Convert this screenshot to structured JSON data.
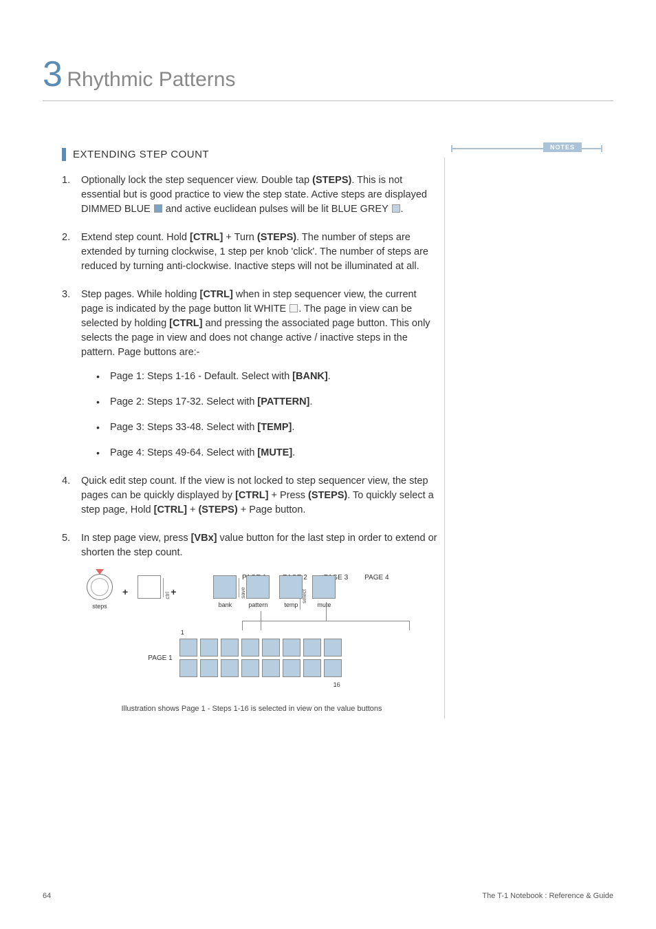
{
  "chapter": {
    "number": "3",
    "title": "Rhythmic Patterns"
  },
  "notes_label": "NOTES",
  "section_title": "EXTENDING STEP COUNT",
  "steps": {
    "s1a": "Optionally lock the step sequencer view. Double tap ",
    "s1b": ". This is not essential but is good practice to view the step state. Active steps are displayed DIMMED BLUE ",
    "s1c": " and active euclidean pulses will be lit BLUE GREY ",
    "s1d": ".",
    "kw_steps": "(STEPS)",
    "s2a": "Extend step count. Hold ",
    "s2b": " + Turn ",
    "s2c": ". The number of steps are extended by turning clockwise, 1 step per knob 'click'. The number of steps are reduced by turning anti-clockwise. Inactive steps will not be illuminated at all.",
    "kw_ctrl": "[CTRL]",
    "s3a": "Step pages. While holding ",
    "s3b": " when in step sequencer view, the current page is indicated by the page button lit WHITE ",
    "s3c": ". The page in view can be selected by holding ",
    "s3d": " and pressing the associated page button. This only selects the page in view and does not change active / inactive steps in the pattern. Page buttons are:-",
    "sub1a": "Page 1: Steps 1-16 - Default. Select with ",
    "sub1b": ".",
    "kw_bank": "[BANK]",
    "sub2a": "Page 2: Steps 17-32. Select with ",
    "kw_pattern": "[PATTERN]",
    "sub3a": "Page 3: Steps 33-48. Select with ",
    "kw_temp": "[TEMP]",
    "sub4a": "Page 4: Steps 49-64. Select with ",
    "kw_mute": "[MUTE]",
    "s4a": "Quick edit step count. If the view is not locked to step sequencer view, the step pages can be quickly displayed by ",
    "s4b": " + Press ",
    "s4c": ". To quickly select a step page, Hold ",
    "s4d": " + ",
    "s4e": " + Page button.",
    "s5a": "In step page view, press ",
    "kw_vbx": "[VBx]",
    "s5b": " value button for the last step in order to extend or shorten the step count."
  },
  "diagram": {
    "page1": "PAGE 1",
    "page2": "PAGE 2",
    "page3": "PAGE 3",
    "page4": "PAGE 4",
    "steps_lbl": "steps",
    "plus": "+",
    "ctrl_txt": "ctrl",
    "save_txt": "save",
    "select_txt": "select",
    "bank": "bank",
    "pattern": "pattern",
    "temp": "temp",
    "mute": "mute",
    "page1_side": "PAGE 1",
    "one": "1",
    "sixteen": "16"
  },
  "caption": "Illustration shows Page 1 - Steps 1-16 is selected in view on the value buttons",
  "footer": {
    "page": "64",
    "book": "The T-1 Notebook : Reference & Guide"
  }
}
